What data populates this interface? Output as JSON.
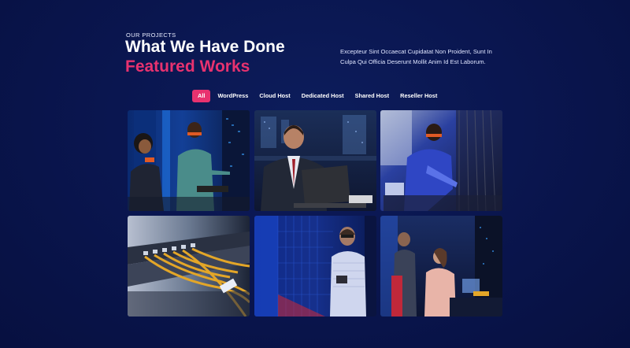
{
  "header": {
    "eyebrow": "OUR PROJECTS",
    "title": "What We Have Done",
    "subtitle": "Featured Works",
    "description": "Excepteur Sint Occaecat Cupidatat Non Proident, Sunt In Culpa Qui Officia Deserunt Mollit Anim Id Est Laborum."
  },
  "filters": [
    {
      "label": "All",
      "active": true
    },
    {
      "label": "WordPress",
      "active": false
    },
    {
      "label": "Cloud Host",
      "active": false
    },
    {
      "label": "Dedicated Host",
      "active": false
    },
    {
      "label": "Shared Host",
      "active": false
    },
    {
      "label": "Reseller Host",
      "active": false
    }
  ],
  "colors": {
    "background": "#0a1650",
    "accent": "#e8326f",
    "text": "#ffffff"
  },
  "works": [
    {
      "scene": "two-technicians-server-aisle"
    },
    {
      "scene": "man-with-laptop"
    },
    {
      "scene": "technician-working-cables"
    },
    {
      "scene": "network-switch-cables"
    },
    {
      "scene": "engineer-server-rack"
    },
    {
      "scene": "team-at-computer"
    }
  ]
}
